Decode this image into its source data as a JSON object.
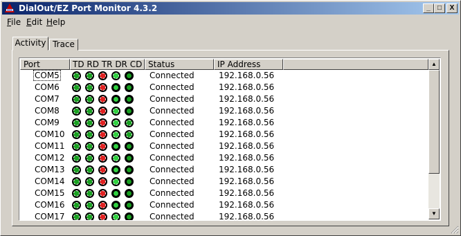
{
  "window": {
    "title": "DialOut/EZ Port Monitor 4.3.2"
  },
  "titlebar_buttons": {
    "minimize": "_",
    "maximize": "□",
    "close": "X"
  },
  "menu": [
    {
      "accel": "F",
      "rest": "ile"
    },
    {
      "accel": "E",
      "rest": "dit"
    },
    {
      "accel": "H",
      "rest": "elp"
    }
  ],
  "tabs": [
    {
      "label": "Activity",
      "selected": true
    },
    {
      "label": "Trace",
      "selected": false
    }
  ],
  "columns": {
    "port": "Port",
    "td": "TD",
    "rd": "RD",
    "tr": "TR",
    "dr": "DR",
    "cd": "CD",
    "status": "Status",
    "ip": "IP Address"
  },
  "scroll_arrows": {
    "up": "▲",
    "down": "▼"
  },
  "led_colors": {
    "td": "#18a020",
    "rd": "#18a020",
    "tr": "#e02020",
    "dr": "#30d040",
    "cd": "#18a020"
  },
  "rows": [
    {
      "port": "COM5",
      "status": "Connected",
      "ip": "192.168.0.56",
      "leds": {
        "td": "on",
        "rd": "on",
        "tr": "on",
        "dr": "on",
        "cd": "off"
      }
    },
    {
      "port": "COM6",
      "status": "Connected",
      "ip": "192.168.0.56",
      "leds": {
        "td": "on",
        "rd": "on",
        "tr": "on",
        "dr": "off",
        "cd": "off"
      }
    },
    {
      "port": "COM7",
      "status": "Connected",
      "ip": "192.168.0.56",
      "leds": {
        "td": "on",
        "rd": "on",
        "tr": "on",
        "dr": "off",
        "cd": "off"
      }
    },
    {
      "port": "COM8",
      "status": "Connected",
      "ip": "192.168.0.56",
      "leds": {
        "td": "on",
        "rd": "on",
        "tr": "on",
        "dr": "on",
        "cd": "off"
      }
    },
    {
      "port": "COM9",
      "status": "Connected",
      "ip": "192.168.0.56",
      "leds": {
        "td": "on",
        "rd": "on",
        "tr": "on",
        "dr": "on",
        "cd": "on"
      }
    },
    {
      "port": "COM10",
      "status": "Connected",
      "ip": "192.168.0.56",
      "leds": {
        "td": "on",
        "rd": "on",
        "tr": "on",
        "dr": "on",
        "cd": "on"
      }
    },
    {
      "port": "COM11",
      "status": "Connected",
      "ip": "192.168.0.56",
      "leds": {
        "td": "on",
        "rd": "on",
        "tr": "on",
        "dr": "off",
        "cd": "off"
      }
    },
    {
      "port": "COM12",
      "status": "Connected",
      "ip": "192.168.0.56",
      "leds": {
        "td": "on",
        "rd": "on",
        "tr": "on",
        "dr": "on",
        "cd": "off"
      }
    },
    {
      "port": "COM13",
      "status": "Connected",
      "ip": "192.168.0.56",
      "leds": {
        "td": "on",
        "rd": "on",
        "tr": "on",
        "dr": "off",
        "cd": "off"
      }
    },
    {
      "port": "COM14",
      "status": "Connected",
      "ip": "192.168.0.56",
      "leds": {
        "td": "on",
        "rd": "on",
        "tr": "on",
        "dr": "on",
        "cd": "off"
      }
    },
    {
      "port": "COM15",
      "status": "Connected",
      "ip": "192.168.0.56",
      "leds": {
        "td": "on",
        "rd": "on",
        "tr": "on",
        "dr": "off",
        "cd": "off"
      }
    },
    {
      "port": "COM16",
      "status": "Connected",
      "ip": "192.168.0.56",
      "leds": {
        "td": "on",
        "rd": "on",
        "tr": "on",
        "dr": "off",
        "cd": "off"
      }
    },
    {
      "port": "COM17",
      "status": "Connected",
      "ip": "192.168.0.56",
      "leds": {
        "td": "on",
        "rd": "on",
        "tr": "on",
        "dr": "on",
        "cd": "off"
      }
    }
  ]
}
